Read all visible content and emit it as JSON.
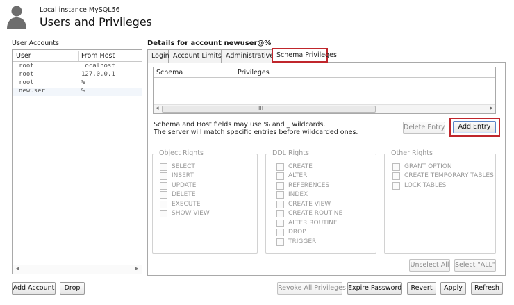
{
  "header": {
    "instance": "Local instance MySQL56",
    "title": "Users and Privileges"
  },
  "accounts": {
    "label": "User Accounts",
    "columns": [
      "User",
      "From Host"
    ],
    "rows": [
      {
        "user": "root",
        "host": "localhost"
      },
      {
        "user": "root",
        "host": "127.0.0.1"
      },
      {
        "user": "root",
        "host": "%"
      },
      {
        "user": "newuser",
        "host": "%"
      }
    ]
  },
  "details": {
    "title": "Details for account newuser@%",
    "tabs": [
      "Login",
      "Account Limits",
      "Administrative Roles",
      "Schema Privileges"
    ],
    "active_tab": "Schema Privileges",
    "schema_columns": [
      "Schema",
      "Privileges"
    ],
    "scroll_thumb_label": "III",
    "info_line1": "Schema and Host fields may use % and _ wildcards.",
    "info_line2": "The server will match specific entries before wildcarded ones.",
    "delete_entry": "Delete Entry",
    "add_entry": "Add Entry"
  },
  "groups": {
    "object": {
      "title": "Object Rights",
      "items": [
        "SELECT",
        "INSERT",
        "UPDATE",
        "DELETE",
        "EXECUTE",
        "SHOW VIEW"
      ]
    },
    "ddl": {
      "title": "DDL Rights",
      "items": [
        "CREATE",
        "ALTER",
        "REFERENCES",
        "INDEX",
        "CREATE VIEW",
        "CREATE ROUTINE",
        "ALTER ROUTINE",
        "DROP",
        "TRIGGER"
      ]
    },
    "other": {
      "title": "Other Rights",
      "items": [
        "GRANT OPTION",
        "CREATE TEMPORARY TABLES",
        "LOCK TABLES"
      ]
    }
  },
  "buttons": {
    "unselect_all": "Unselect All",
    "select_all": "Select \"ALL\"",
    "add_account": "Add Account",
    "drop": "Drop",
    "revoke_all": "Revoke All Privileges",
    "expire_password": "Expire Password",
    "revert": "Revert",
    "apply": "Apply",
    "refresh": "Refresh"
  },
  "icons": {
    "avatar": "user-silhouette-icon",
    "scroll_left": "arrow-left-icon",
    "scroll_right": "arrow-right-icon"
  },
  "colors": {
    "highlight": "#c0262c",
    "selected_row": "#f2f6fb"
  }
}
